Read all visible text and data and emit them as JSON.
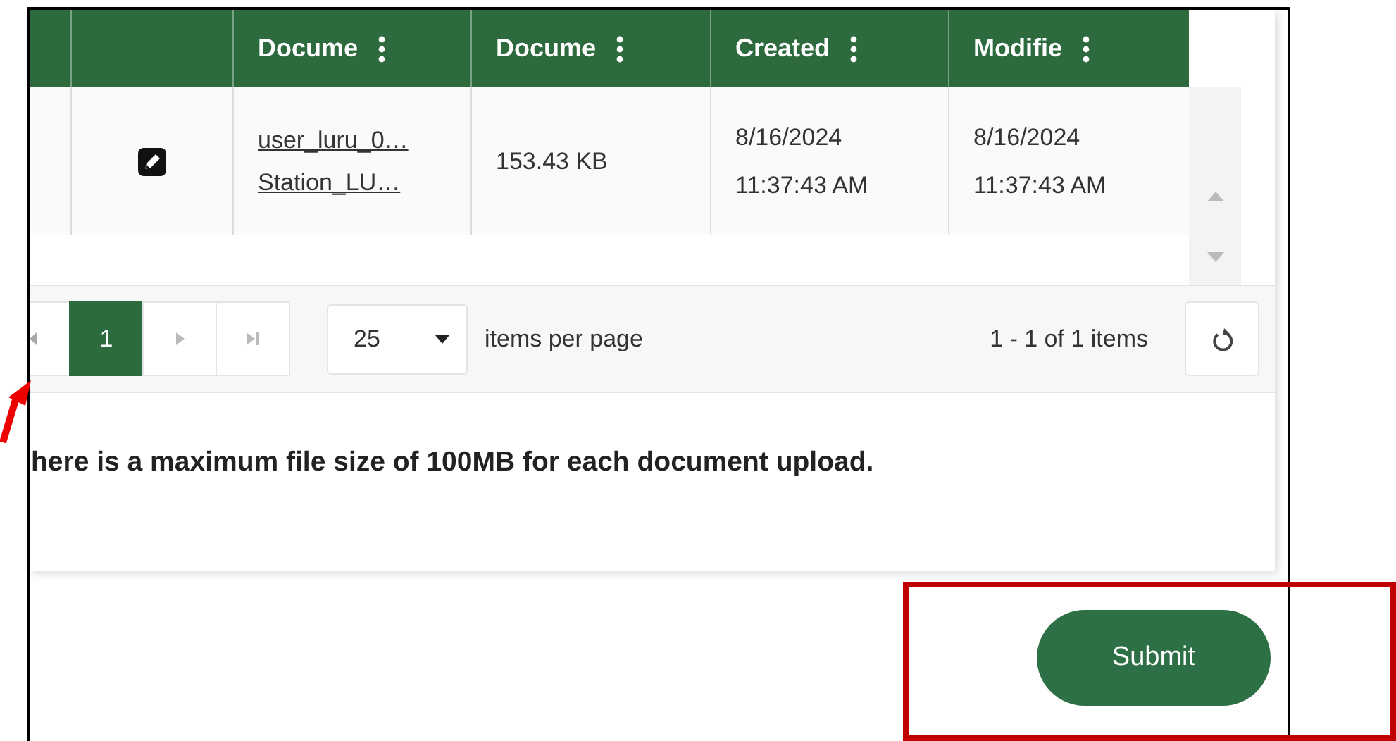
{
  "grid": {
    "columns": [
      "Docume",
      "Docume",
      "Created",
      "Modifie"
    ],
    "rows": [
      {
        "links": [
          "user_luru_0…",
          "Station_LU…"
        ],
        "size": "153.43 KB",
        "created": "8/16/2024 11:37:43 AM",
        "modified": "8/16/2024 11:37:43 AM"
      }
    ]
  },
  "pager": {
    "pages": [
      {
        "label": "1",
        "selected": true
      }
    ],
    "page_size": "25",
    "page_size_label": "items per page",
    "summary": "1 - 1 of 1 items"
  },
  "note": "here is a maximum file size of 100MB for each document upload.",
  "submit": "Submit"
}
